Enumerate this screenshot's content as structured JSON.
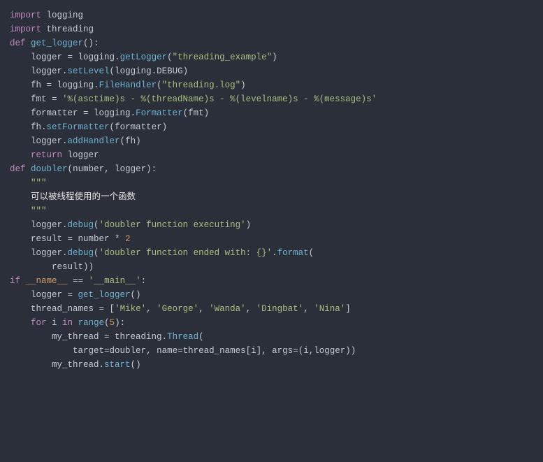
{
  "code": {
    "lines": [
      [
        [
          "kw",
          "import"
        ],
        [
          "id",
          " logging"
        ]
      ],
      [
        [
          "kw",
          "import"
        ],
        [
          "id",
          " threading"
        ]
      ],
      [
        [
          "id",
          ""
        ]
      ],
      [
        [
          "kw",
          "def"
        ],
        [
          "id",
          " "
        ],
        [
          "fn",
          "get_logger"
        ],
        [
          "op",
          "():"
        ]
      ],
      [
        [
          "id",
          "    logger "
        ],
        [
          "op",
          "= "
        ],
        [
          "id",
          "logging"
        ],
        [
          "op",
          "."
        ],
        [
          "fn",
          "getLogger"
        ],
        [
          "op",
          "("
        ],
        [
          "str",
          "\"threading_example\""
        ],
        [
          "op",
          ")"
        ]
      ],
      [
        [
          "id",
          "    logger"
        ],
        [
          "op",
          "."
        ],
        [
          "fn",
          "setLevel"
        ],
        [
          "op",
          "("
        ],
        [
          "id",
          "logging"
        ],
        [
          "op",
          "."
        ],
        [
          "id",
          "DEBUG"
        ],
        [
          "op",
          ")"
        ]
      ],
      [
        [
          "id",
          ""
        ]
      ],
      [
        [
          "id",
          "    fh "
        ],
        [
          "op",
          "= "
        ],
        [
          "id",
          "logging"
        ],
        [
          "op",
          "."
        ],
        [
          "fn",
          "FileHandler"
        ],
        [
          "op",
          "("
        ],
        [
          "str",
          "\"threading.log\""
        ],
        [
          "op",
          ")"
        ]
      ],
      [
        [
          "id",
          "    fmt "
        ],
        [
          "op",
          "= "
        ],
        [
          "str",
          "'%(asctime)s - %(threadName)s - %(levelname)s - %(message)s'"
        ]
      ],
      [
        [
          "id",
          "    formatter "
        ],
        [
          "op",
          "= "
        ],
        [
          "id",
          "logging"
        ],
        [
          "op",
          "."
        ],
        [
          "fn",
          "Formatter"
        ],
        [
          "op",
          "("
        ],
        [
          "id",
          "fmt"
        ],
        [
          "op",
          ")"
        ]
      ],
      [
        [
          "id",
          "    fh"
        ],
        [
          "op",
          "."
        ],
        [
          "fn",
          "setFormatter"
        ],
        [
          "op",
          "("
        ],
        [
          "id",
          "formatter"
        ],
        [
          "op",
          ")"
        ]
      ],
      [
        [
          "id",
          ""
        ]
      ],
      [
        [
          "id",
          "    logger"
        ],
        [
          "op",
          "."
        ],
        [
          "fn",
          "addHandler"
        ],
        [
          "op",
          "("
        ],
        [
          "id",
          "fh"
        ],
        [
          "op",
          ")"
        ]
      ],
      [
        [
          "id",
          "    "
        ],
        [
          "kw",
          "return"
        ],
        [
          "id",
          " logger"
        ]
      ],
      [
        [
          "id",
          ""
        ]
      ],
      [
        [
          "id",
          ""
        ]
      ],
      [
        [
          "kw",
          "def"
        ],
        [
          "id",
          " "
        ],
        [
          "fn",
          "doubler"
        ],
        [
          "op",
          "("
        ],
        [
          "id",
          "number"
        ],
        [
          "op",
          ", "
        ],
        [
          "id",
          "logger"
        ],
        [
          "op",
          "):"
        ]
      ],
      [
        [
          "id",
          "    "
        ],
        [
          "str",
          "\"\"\""
        ]
      ],
      [
        [
          "id",
          "    "
        ],
        [
          "cmt",
          "可以被线程使用的一个函数"
        ]
      ],
      [
        [
          "id",
          "    "
        ],
        [
          "str",
          "\"\"\""
        ]
      ],
      [
        [
          "id",
          "    logger"
        ],
        [
          "op",
          "."
        ],
        [
          "fn",
          "debug"
        ],
        [
          "op",
          "("
        ],
        [
          "str",
          "'doubler function executing'"
        ],
        [
          "op",
          ")"
        ]
      ],
      [
        [
          "id",
          "    result "
        ],
        [
          "op",
          "= "
        ],
        [
          "id",
          "number "
        ],
        [
          "op",
          "* "
        ],
        [
          "num",
          "2"
        ]
      ],
      [
        [
          "id",
          "    logger"
        ],
        [
          "op",
          "."
        ],
        [
          "fn",
          "debug"
        ],
        [
          "op",
          "("
        ],
        [
          "str",
          "'doubler function ended with: {}'"
        ],
        [
          "op",
          "."
        ],
        [
          "fn",
          "format"
        ],
        [
          "op",
          "("
        ]
      ],
      [
        [
          "id",
          "        result"
        ],
        [
          "op",
          "))"
        ]
      ],
      [
        [
          "id",
          ""
        ]
      ],
      [
        [
          "id",
          ""
        ]
      ],
      [
        [
          "kw",
          "if"
        ],
        [
          "id",
          " "
        ],
        [
          "mag",
          "__name__"
        ],
        [
          "id",
          " "
        ],
        [
          "op",
          "== "
        ],
        [
          "str",
          "'__main__'"
        ],
        [
          "op",
          ":"
        ]
      ],
      [
        [
          "id",
          "    logger "
        ],
        [
          "op",
          "= "
        ],
        [
          "fn",
          "get_logger"
        ],
        [
          "op",
          "()"
        ]
      ],
      [
        [
          "id",
          "    thread_names "
        ],
        [
          "op",
          "= "
        ],
        [
          "op",
          "["
        ],
        [
          "str",
          "'Mike'"
        ],
        [
          "op",
          ", "
        ],
        [
          "str",
          "'George'"
        ],
        [
          "op",
          ", "
        ],
        [
          "str",
          "'Wanda'"
        ],
        [
          "op",
          ", "
        ],
        [
          "str",
          "'Dingbat'"
        ],
        [
          "op",
          ", "
        ],
        [
          "str",
          "'Nina'"
        ],
        [
          "op",
          "]"
        ]
      ],
      [
        [
          "id",
          "    "
        ],
        [
          "kw",
          "for"
        ],
        [
          "id",
          " i "
        ],
        [
          "kw",
          "in"
        ],
        [
          "id",
          " "
        ],
        [
          "bi",
          "range"
        ],
        [
          "op",
          "("
        ],
        [
          "num",
          "5"
        ],
        [
          "op",
          "):"
        ]
      ],
      [
        [
          "id",
          "        my_thread "
        ],
        [
          "op",
          "= "
        ],
        [
          "id",
          "threading"
        ],
        [
          "op",
          "."
        ],
        [
          "fn",
          "Thread"
        ],
        [
          "op",
          "("
        ]
      ],
      [
        [
          "id",
          "            target"
        ],
        [
          "op",
          "="
        ],
        [
          "id",
          "doubler"
        ],
        [
          "op",
          ", "
        ],
        [
          "id",
          "name"
        ],
        [
          "op",
          "="
        ],
        [
          "id",
          "thread_names"
        ],
        [
          "op",
          "["
        ],
        [
          "id",
          "i"
        ],
        [
          "op",
          "], "
        ],
        [
          "id",
          "args"
        ],
        [
          "op",
          "=("
        ],
        [
          "id",
          "i"
        ],
        [
          "op",
          ","
        ],
        [
          "id",
          "logger"
        ],
        [
          "op",
          "))"
        ]
      ],
      [
        [
          "id",
          "        my_thread"
        ],
        [
          "op",
          "."
        ],
        [
          "fn",
          "start"
        ],
        [
          "op",
          "()"
        ]
      ]
    ]
  }
}
